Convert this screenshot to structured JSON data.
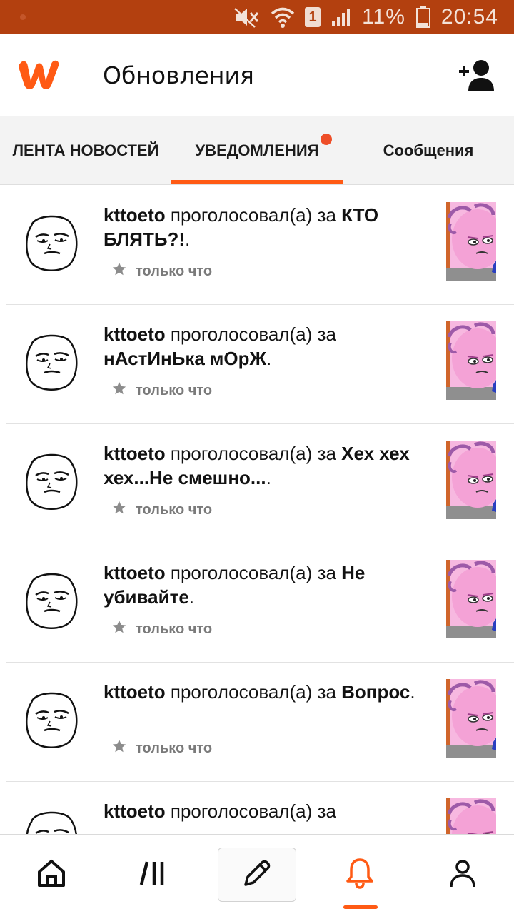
{
  "status_bar": {
    "battery_percent": "11%",
    "time": "20:54",
    "sim_slot": "1",
    "icons": [
      "mute-icon",
      "wifi-icon",
      "sim-icon",
      "signal-icon",
      "battery-icon"
    ]
  },
  "header": {
    "title": "Обновления",
    "logo_icon": "wattpad-logo",
    "action_icon": "add-user-icon",
    "brand_color": "#ff5a14"
  },
  "tabs": [
    {
      "label": "ЛЕНТА НОВОСТЕЙ",
      "active": false
    },
    {
      "label": "УВЕДОМЛЕНИЯ",
      "active": true,
      "has_badge": true
    },
    {
      "label": "Сообщения",
      "active": false
    }
  ],
  "notifications": [
    {
      "user": "kttoeto",
      "action": " проголосовал(а) за ",
      "title": "КТО БЛЯТЬ?!",
      "suffix": ".",
      "time": "только что"
    },
    {
      "user": "kttoeto",
      "action": " проголосовал(а) за ",
      "title": "нАстИнЬка мОрЖ",
      "suffix": ".",
      "time": "только что"
    },
    {
      "user": "kttoeto",
      "action": " проголосовал(а) за ",
      "title": "Хех хех хех...Не смешно...",
      "suffix": ".",
      "time": "только что"
    },
    {
      "user": "kttoeto",
      "action": " проголосовал(а) за ",
      "title": "Не убивайте",
      "suffix": ".",
      "time": "только что"
    },
    {
      "user": "kttoeto",
      "action": " проголосовал(а) за ",
      "title": "Вопрос",
      "suffix": ".",
      "time": "только что"
    },
    {
      "user": "kttoeto",
      "action": " проголосовал(а) за",
      "title": "",
      "suffix": "",
      "time": ""
    }
  ],
  "bottom_nav": [
    {
      "icon": "home-icon",
      "active": false
    },
    {
      "icon": "library-icon",
      "active": false
    },
    {
      "icon": "pencil-icon",
      "active": false
    },
    {
      "icon": "bell-icon",
      "active": true
    },
    {
      "icon": "profile-icon",
      "active": false
    }
  ]
}
